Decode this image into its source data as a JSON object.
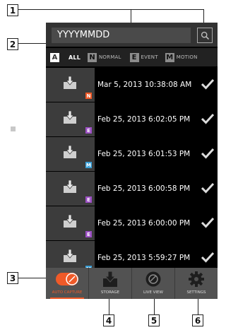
{
  "callouts": [
    "1",
    "2",
    "3",
    "4",
    "5",
    "6"
  ],
  "search": {
    "value": "YYYYMMDD"
  },
  "filters": [
    {
      "badge": "A",
      "label": "ALL"
    },
    {
      "badge": "N",
      "label": "NORMAL"
    },
    {
      "badge": "E",
      "label": "EVENT"
    },
    {
      "badge": "M",
      "label": "MOTION"
    }
  ],
  "records": [
    {
      "timestamp": "Mar 5, 2013 10:38:08 AM",
      "type": "N",
      "type_color": "#f05a28"
    },
    {
      "timestamp": "Feb 25, 2013 6:02:05 PM",
      "type": "E",
      "type_color": "#9c4fc4"
    },
    {
      "timestamp": "Feb 25, 2013 6:01:53 PM",
      "type": "M",
      "type_color": "#3aa0d8"
    },
    {
      "timestamp": "Feb 25, 2013 6:00:58 PM",
      "type": "E",
      "type_color": "#9c4fc4"
    },
    {
      "timestamp": "Feb 25, 2013 6:00:00 PM",
      "type": "E",
      "type_color": "#9c4fc4"
    },
    {
      "timestamp": "Feb 25, 2013 5:59:27 PM",
      "type": "M",
      "type_color": "#3aa0d8"
    }
  ],
  "nav": [
    {
      "label": "AUTO CAPTURE",
      "icon": "auto-capture-toggle-icon",
      "active": true
    },
    {
      "label": "STORAGE",
      "icon": "storage-download-icon",
      "active": false
    },
    {
      "label": "LIVE VIEW",
      "icon": "live-view-lens-icon",
      "active": false
    },
    {
      "label": "SETTINGS",
      "icon": "gear-icon",
      "active": false
    }
  ],
  "colors": {
    "accent": "#f05a28",
    "background": "#000000",
    "nav": "#525252"
  }
}
